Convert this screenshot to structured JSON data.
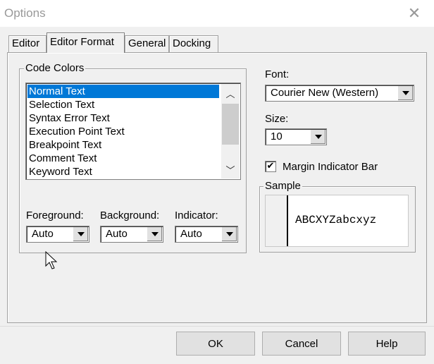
{
  "window": {
    "title": "Options"
  },
  "tabs": [
    {
      "label": "Editor"
    },
    {
      "label": "Editor Format"
    },
    {
      "label": "General"
    },
    {
      "label": "Docking"
    }
  ],
  "code_colors": {
    "group_label": "Code Colors",
    "items": [
      "Normal Text",
      "Selection Text",
      "Syntax Error Text",
      "Execution Point Text",
      "Breakpoint Text",
      "Comment Text",
      "Keyword Text"
    ],
    "selected_index": 0,
    "foreground_label": "Foreground:",
    "foreground_value": "Auto",
    "background_label": "Background:",
    "background_value": "Auto",
    "indicator_label": "Indicator:",
    "indicator_value": "Auto"
  },
  "font": {
    "label": "Font:",
    "value": "Courier New (Western)"
  },
  "size": {
    "label": "Size:",
    "value": "10"
  },
  "margin_indicator": {
    "label": "Margin Indicator Bar",
    "checked": true,
    "check_glyph": "✔"
  },
  "sample": {
    "label": "Sample",
    "text": "ABCXYZabcxyz"
  },
  "buttons": {
    "ok": "OK",
    "cancel": "Cancel",
    "help": "Help"
  },
  "colors": {
    "selection": "#0078d7",
    "background": "#f0f0f0"
  }
}
